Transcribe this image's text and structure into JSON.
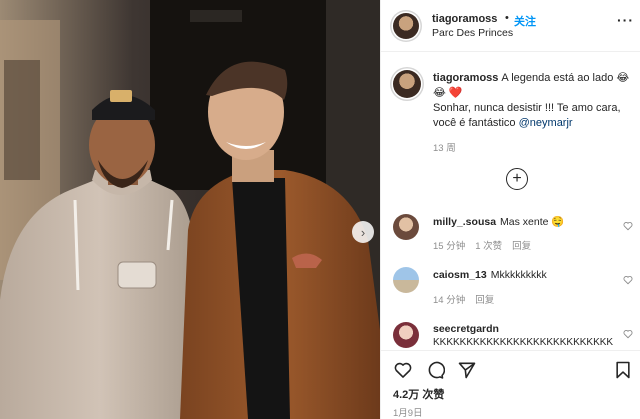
{
  "header": {
    "username": "tiagoramoss",
    "dot": "•",
    "follow_label": "关注",
    "location": "Parc Des Princes",
    "more_label": "···"
  },
  "caption": {
    "username": "tiagoramoss",
    "line1": "A legenda está ao lado 😂",
    "line2": "😂 ❤️",
    "line3": "Sonhar, nunca desistir !!! Te amo cara,",
    "line4": "você é fantástico",
    "mention": "@neymarjr",
    "time": "13 周"
  },
  "load_more_label": "+",
  "photo_next_label": "›",
  "comments": [
    {
      "username": "milly_.sousa",
      "text": "Mas xente 🤤",
      "time": "15 分钟",
      "likes": "1 次赞",
      "reply": "回复"
    },
    {
      "username": "caiosm_13",
      "text": "Mkkkkkkkkk",
      "time": "14 分钟",
      "reply": "回复"
    },
    {
      "username": "seecretgardn",
      "text": "KKKKKKKKKKKKKKKKKKKKKKKKKKK"
    }
  ],
  "likes_label": "4.2万 次赞",
  "date_label": "1月9日",
  "icons": {
    "like": "heart-outline",
    "comment": "speech-bubble",
    "share": "paper-plane",
    "save": "bookmark",
    "comment_like": "heart-outline-small"
  }
}
